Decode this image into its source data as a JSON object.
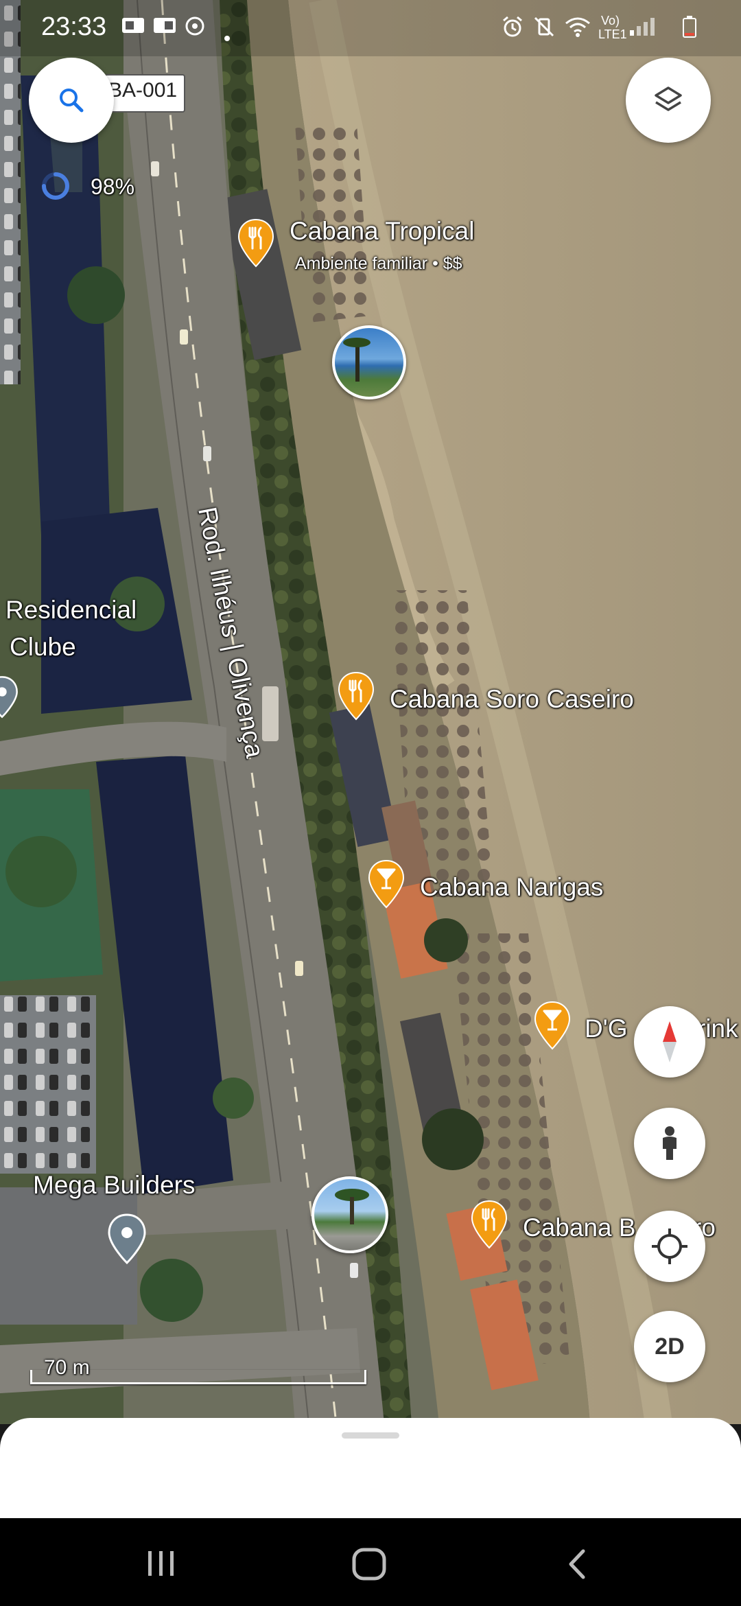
{
  "status_bar": {
    "time": "23:33",
    "battery_icon": "battery-low-icon",
    "network_label": "LTE1",
    "volte_label": "Vo)"
  },
  "map": {
    "road_badge": "BA-001",
    "loading_percent": "98%",
    "road_label": "Rod. Ilhéus | Olivença",
    "area_labels": [
      "Residencial",
      "Clube",
      "Mega Builders"
    ],
    "scale_label": "70 m"
  },
  "pois": [
    {
      "name": "Cabana Tropical",
      "subtitle": "Ambiente familiar • $$",
      "icon": "restaurant-icon",
      "color": "#f39c12"
    },
    {
      "name": "Cabana Soro Caseiro",
      "icon": "restaurant-icon",
      "color": "#f39c12"
    },
    {
      "name": "Cabana Narigas",
      "icon": "bar-icon",
      "color": "#f39c12"
    },
    {
      "name": "D'G",
      "name_suffix": "rink",
      "icon": "bar-icon",
      "color": "#f39c12"
    },
    {
      "name": "Cabana B",
      "name_suffix": "ro",
      "icon": "restaurant-icon",
      "color": "#f39c12"
    }
  ],
  "controls": {
    "search_icon": "search-icon",
    "layers_icon": "layers-icon",
    "compass_icon": "compass-icon",
    "street_view_icon": "pegman-icon",
    "my_location_icon": "my-location-icon",
    "view_mode_label": "2D"
  },
  "nav_bar": {
    "recents_icon": "recents-icon",
    "home_icon": "home-icon",
    "back_icon": "back-icon"
  }
}
